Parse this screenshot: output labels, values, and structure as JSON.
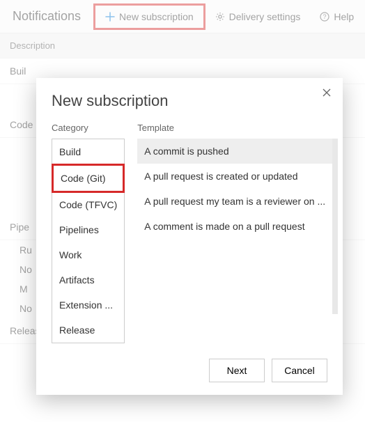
{
  "toolbar": {
    "title": "Notifications",
    "new_subscription": "New subscription",
    "delivery_settings": "Delivery settings",
    "help": "Help"
  },
  "description_header": "Description",
  "modal": {
    "title": "New subscription",
    "category_label": "Category",
    "template_label": "Template",
    "categories": [
      "Build",
      "Code (Git)",
      "Code (TFVC)",
      "Pipelines",
      "Work",
      "Artifacts",
      "Extension ...",
      "Release"
    ],
    "selected_category_index": 1,
    "templates": [
      "A commit is pushed",
      "A pull request is created or updated",
      "A pull request my team is a reviewer on ...",
      "A comment is made on a pull request"
    ],
    "selected_template_index": 0,
    "next": "Next",
    "cancel": "Cancel"
  },
  "background": {
    "sections": [
      "Buil",
      "Code",
      "Pipe",
      "Release"
    ],
    "rows": [
      "Ru",
      "No",
      "M",
      "No"
    ]
  }
}
